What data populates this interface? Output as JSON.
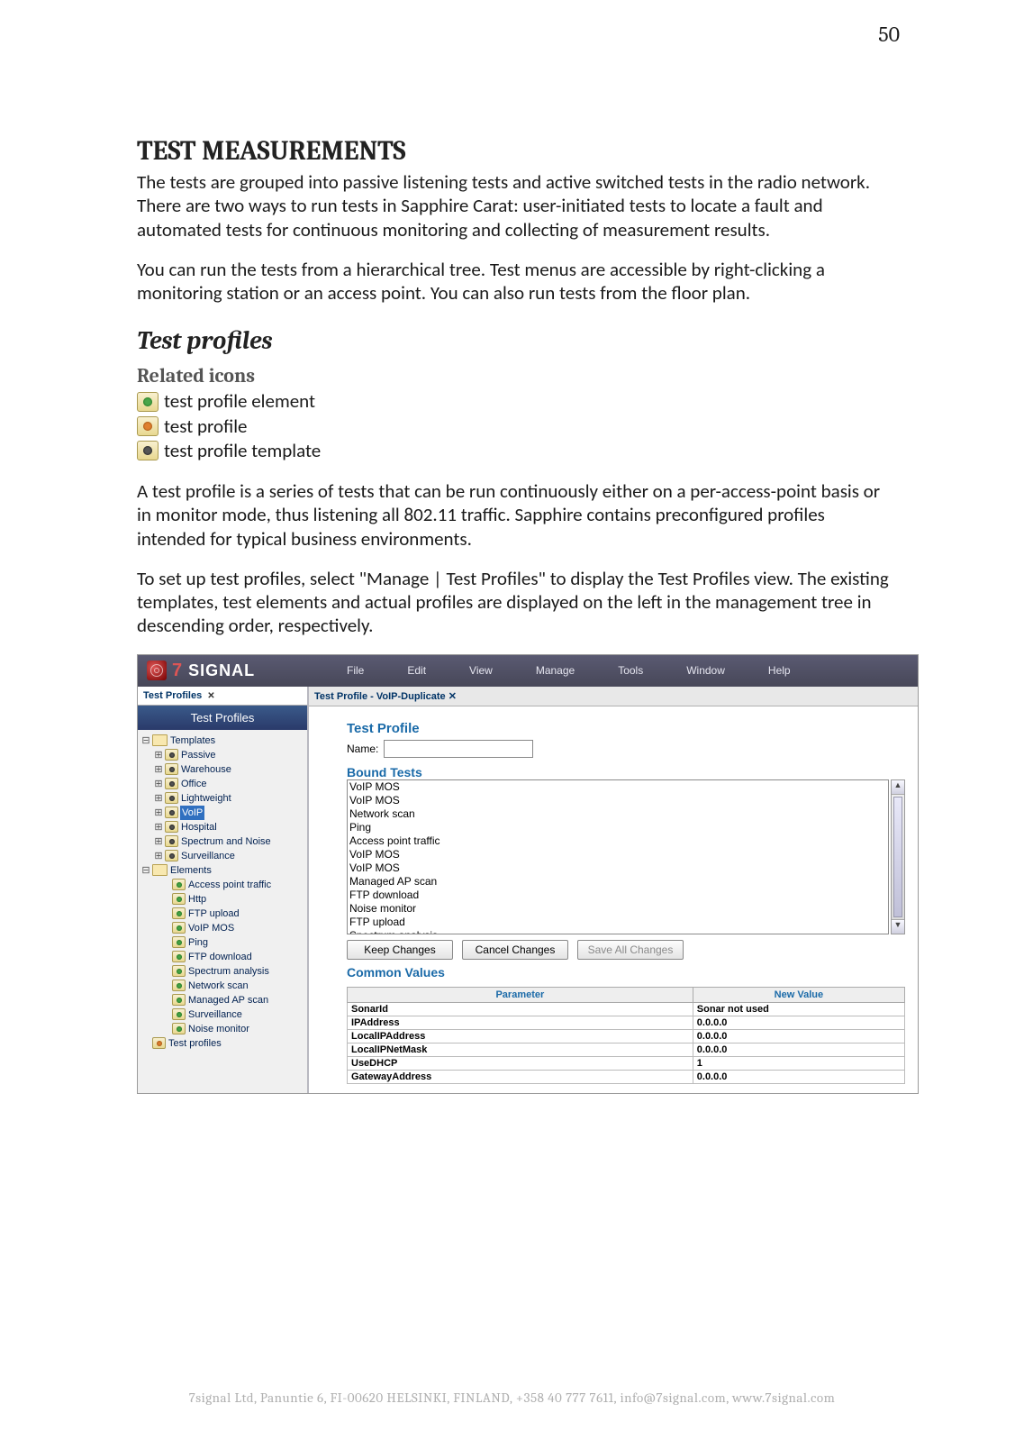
{
  "page_number": "50",
  "heading": "TEST MEASUREMENTS",
  "para1": "The tests are grouped into passive listening tests and active switched tests in the radio network. There are two ways to run tests in Sapphire Carat: user-initiated tests to locate a fault and automated tests for continuous monitoring and collecting of measurement results.",
  "para2": "You can run the tests from a hierarchical tree. Test menus are accessible by right-clicking a monitoring station or an access point. You can also run tests from the floor plan.",
  "h2": "Test profiles",
  "h3": "Related icons",
  "icon_labels": {
    "element": " test profile element",
    "profile": " test profile",
    "template": " test profile template"
  },
  "para3": "A test profile is a series of tests that can be run continuously either on a per-access-point basis or in monitor mode, thus listening all 802.11 traffic. Sapphire contains preconfigured profiles intended for typical business environments.",
  "para4": "To set up test profiles, select \"Manage | Test Profiles\" to display the Test Profiles view. The existing templates, test elements and actual profiles are displayed on the left in the management tree in descending order, respectively.",
  "app": {
    "logo_brand": "7",
    "logo_text": "SIGNAL",
    "menus": [
      "File",
      "Edit",
      "View",
      "Manage",
      "Tools",
      "Window",
      "Help"
    ],
    "left_tab": "Test Profiles",
    "left_panel_title": "Test Profiles",
    "tree": {
      "templates_label": "Templates",
      "templates": [
        "Passive",
        "Warehouse",
        "Office",
        "Lightweight",
        "VoIP",
        "Hospital",
        "Spectrum and Noise",
        "Surveillance"
      ],
      "selected_template_index": 4,
      "elements_label": "Elements",
      "elements": [
        "Access point traffic",
        "Http",
        "FTP upload",
        "VoIP MOS",
        "Ping",
        "FTP download",
        "Spectrum analysis",
        "Network scan",
        "Managed AP scan",
        "Surveillance",
        "Noise monitor"
      ],
      "profiles_label": "Test profiles"
    },
    "right_tab": "Test Profile - VoIP-Duplicate",
    "form": {
      "title": "Test Profile",
      "name_label": "Name:",
      "name_value": "",
      "bound_title": "Bound Tests",
      "bound_items": [
        "VoIP MOS",
        "VoIP MOS",
        "Network scan",
        "Ping",
        "Access point traffic",
        "VoIP MOS",
        "VoIP MOS",
        "Managed AP scan",
        "FTP download",
        "Noise monitor",
        "FTP upload",
        "Spectrum analysis"
      ],
      "buttons": {
        "keep": "Keep Changes",
        "cancel": "Cancel Changes",
        "saveall": "Save All Changes"
      },
      "common_title": "Common Values",
      "common_headers": {
        "param": "Parameter",
        "value": "New Value"
      },
      "common_rows": [
        {
          "p": "SonarId",
          "v": "Sonar not used"
        },
        {
          "p": "IPAddress",
          "v": "0.0.0.0"
        },
        {
          "p": "LocalIPAddress",
          "v": "0.0.0.0"
        },
        {
          "p": "LocalIPNetMask",
          "v": "0.0.0.0"
        },
        {
          "p": "UseDHCP",
          "v": "1"
        },
        {
          "p": "GatewayAddress",
          "v": "0.0.0.0"
        }
      ]
    }
  },
  "footer": "7signal Ltd, Panuntie 6, FI-00620 HELSINKI, FINLAND, +358 40 777 7611, info@7signal.com, www.7signal.com"
}
